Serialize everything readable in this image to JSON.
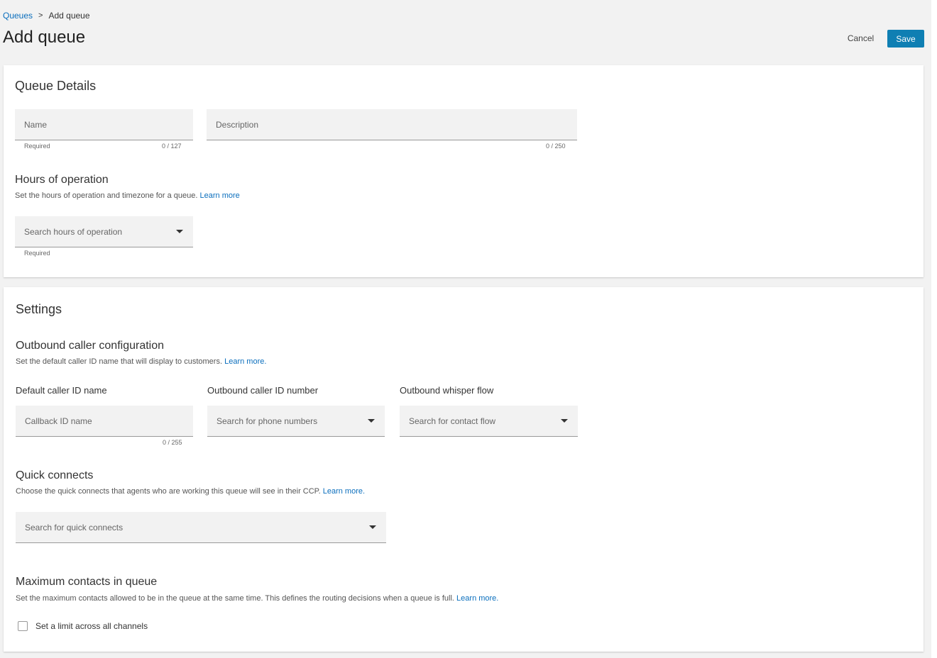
{
  "breadcrumb": {
    "parent": "Queues",
    "separator": ">",
    "current": "Add queue"
  },
  "page_title": "Add queue",
  "actions": {
    "cancel": "Cancel",
    "save": "Save"
  },
  "queue_details": {
    "title": "Queue Details",
    "name": {
      "placeholder": "Name",
      "helper": "Required",
      "counter": "0 / 127"
    },
    "description": {
      "placeholder": "Description",
      "counter": "0 / 250"
    },
    "hours": {
      "title": "Hours of operation",
      "desc": "Set the hours of operation and timezone for a queue.",
      "link": "Learn more",
      "placeholder": "Search hours of operation",
      "helper": "Required"
    }
  },
  "settings": {
    "title": "Settings",
    "outbound": {
      "title": "Outbound caller configuration",
      "desc": "Set the default caller ID name that will display to customers.",
      "link": "Learn more.",
      "default_caller_label": "Default caller ID name",
      "default_caller_placeholder": "Callback ID name",
      "default_caller_counter": "0 / 255",
      "number_label": "Outbound caller ID number",
      "number_placeholder": "Search for phone numbers",
      "whisper_label": "Outbound whisper flow",
      "whisper_placeholder": "Search for contact flow"
    },
    "quick_connects": {
      "title": "Quick connects",
      "desc": "Choose the quick connects that agents who are working this queue will see in their CCP.",
      "link": "Learn more.",
      "placeholder": "Search for quick connects"
    },
    "max_contacts": {
      "title": "Maximum contacts in queue",
      "desc": "Set the maximum contacts allowed to be in the queue at the same time. This defines the routing decisions when a queue is full.",
      "link": "Learn more.",
      "checkbox_label": "Set a limit across all channels"
    }
  },
  "colors": {
    "accent": "#0f7fb3",
    "link": "#0a6ebd",
    "page_bg": "#f2f2f2"
  }
}
